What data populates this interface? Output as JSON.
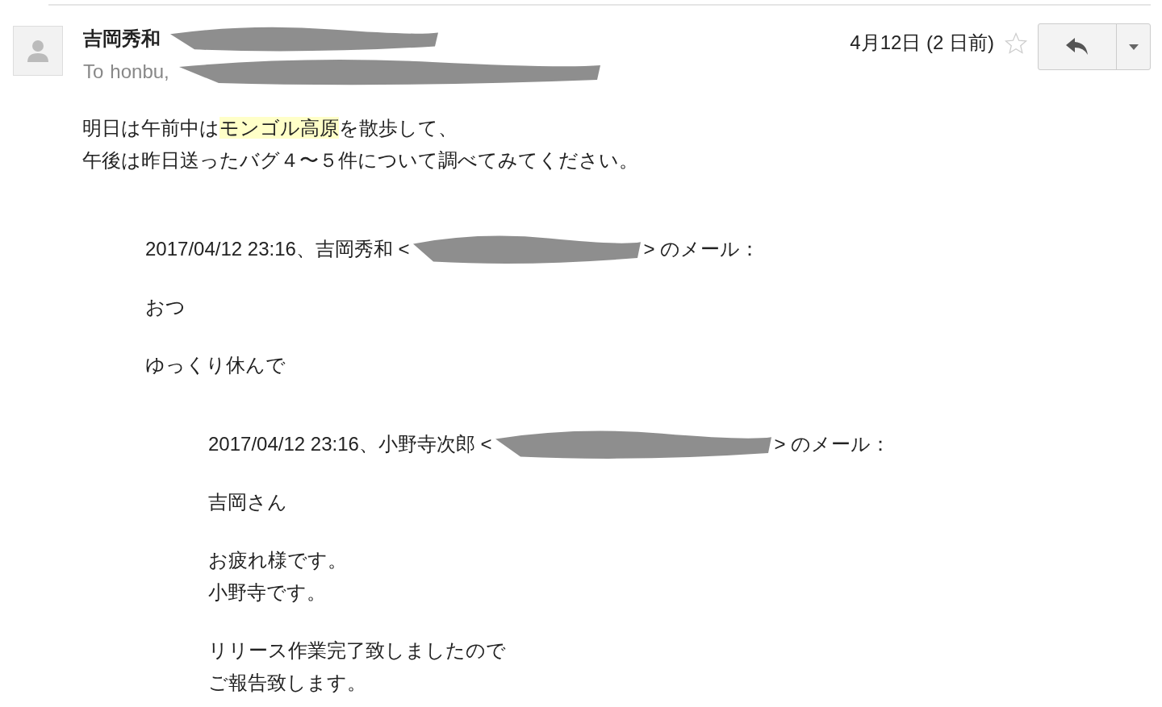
{
  "message": {
    "sender": "吉岡秀和",
    "to_label": "To",
    "recipients": "honbu,",
    "date": "4月12日 (2 日前)",
    "starred": false
  },
  "body": [
    {
      "before": "明日は午前中は",
      "highlight": "モンゴル高原",
      "after": "を散歩して、"
    },
    {
      "before": "午後は昨日送ったバグ４〜５件について調べてみてください。"
    }
  ],
  "quote": {
    "header_prefix": "2017/04/12 23:16、吉岡秀和 <",
    "header_suffix": "> のメール：",
    "paragraphs": [
      [
        "おつ"
      ],
      [
        "ゆっくり休んで"
      ]
    ],
    "quote": {
      "header_prefix": "2017/04/12 23:16、小野寺次郎 <",
      "header_suffix": "> のメール：",
      "paragraphs": [
        [
          "吉岡さん"
        ],
        [
          "お疲れ様です。",
          "小野寺です。"
        ],
        [
          "リリース作業完了致しましたので",
          "ご報告致します。"
        ]
      ]
    }
  }
}
